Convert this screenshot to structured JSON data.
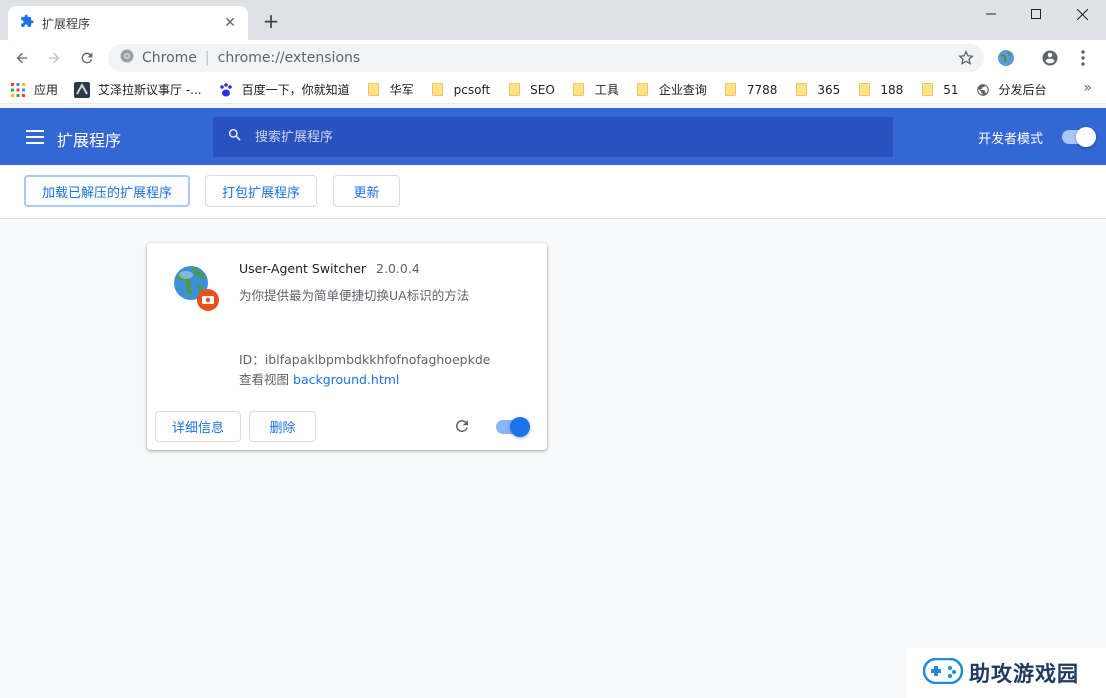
{
  "tab": {
    "title": "扩展程序",
    "close": "✕",
    "new_tab": "+"
  },
  "window": {
    "minimize": "—",
    "maximize": "☐",
    "close": "✕"
  },
  "omnibox": {
    "host": "Chrome",
    "separator": "|",
    "url": "chrome://extensions"
  },
  "bookmarks": [
    {
      "label": "应用",
      "icon": "apps-grid-icon"
    },
    {
      "label": "艾泽拉斯议事厅 -...",
      "icon": "site-icon"
    },
    {
      "label": "百度一下，你就知道",
      "icon": "baidu-paw-icon"
    },
    {
      "label": "华军",
      "icon": "folder-icon"
    },
    {
      "label": "pcsoft",
      "icon": "folder-icon"
    },
    {
      "label": "SEO",
      "icon": "folder-icon"
    },
    {
      "label": "工具",
      "icon": "folder-icon"
    },
    {
      "label": "企业查询",
      "icon": "folder-icon"
    },
    {
      "label": "7788",
      "icon": "folder-icon"
    },
    {
      "label": "365",
      "icon": "folder-icon"
    },
    {
      "label": "188",
      "icon": "folder-icon"
    },
    {
      "label": "51",
      "icon": "folder-icon"
    },
    {
      "label": "分发后台",
      "icon": "globe-icon"
    }
  ],
  "bookmarks_more": "»",
  "header": {
    "title": "扩展程序",
    "search_placeholder": "搜索扩展程序",
    "dev_mode_label": "开发者模式",
    "dev_mode_on": true
  },
  "actions": {
    "load_unpacked": "加载已解压的扩展程序",
    "pack": "打包扩展程序",
    "update": "更新"
  },
  "extension": {
    "name": "User-Agent Switcher",
    "version": "2.0.0.4",
    "description": "为你提供最为简单便捷切换UA标识的方法",
    "id_label": "ID：",
    "id": "iblfapaklbpmbdkkhfofnofaghoepkde",
    "views_label": "查看视图",
    "views_link": "background.html",
    "details_button": "详细信息",
    "remove_button": "删除",
    "enabled": true
  },
  "watermark": {
    "text": "助攻游戏园"
  },
  "colors": {
    "header_bg": "#3367d6",
    "search_bg": "#2a52be",
    "accent": "#1a73e8"
  }
}
